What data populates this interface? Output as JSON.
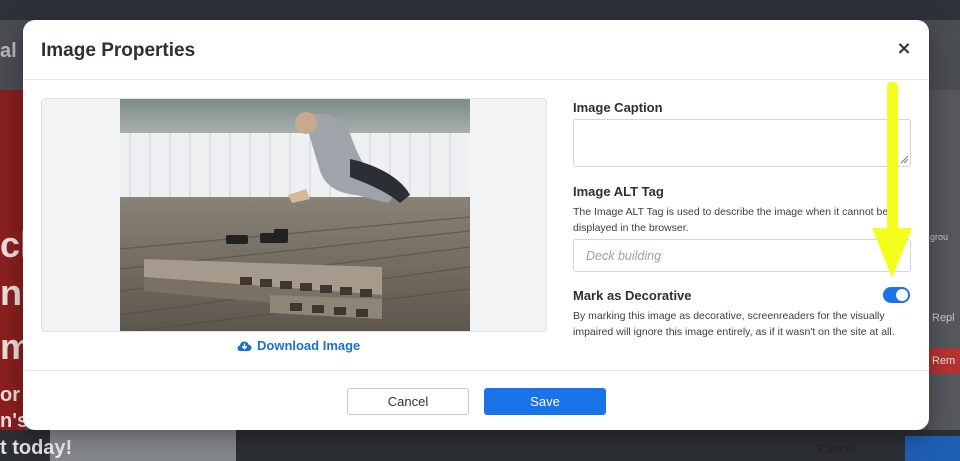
{
  "background": {
    "partial_left_1": "ck",
    "partial_left_2": "nc",
    "partial_left_3": "m",
    "partial_left_4": "or",
    "partial_left_5": "n's",
    "partial_left_6": "t today!",
    "partial_top_left": "al",
    "partial_right_1": "grou",
    "partial_right_2": "Repl",
    "partial_right_3": "Rem",
    "partial_bottom_cancel": "Cancel"
  },
  "modal": {
    "title": "Image Properties",
    "close_label": "×",
    "download_label": "Download Image",
    "caption": {
      "label": "Image Caption",
      "value": ""
    },
    "alt_tag": {
      "label": "Image ALT Tag",
      "help": "The Image ALT Tag is used to describe the image when it cannot be displayed in the browser.",
      "placeholder": "Deck building"
    },
    "decorative": {
      "label": "Mark as Decorative",
      "help": "By marking this image as decorative, screenreaders for the visually impaired will ignore this image entirely, as if it wasn't on the site at all.",
      "enabled": true
    },
    "footer": {
      "cancel_label": "Cancel",
      "save_label": "Save"
    }
  },
  "colors": {
    "accent": "#1a73e8",
    "annotation_arrow": "#f5ff1e"
  },
  "icons": {
    "close": "close-icon",
    "download": "cloud-download-icon",
    "annotation": "arrow-down-annotation"
  }
}
